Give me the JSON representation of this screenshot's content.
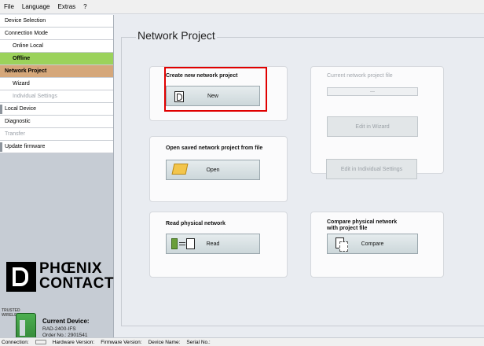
{
  "menu": {
    "items": [
      "File",
      "Language",
      "Extras",
      "?"
    ]
  },
  "sidebar": {
    "items": [
      {
        "label": "Device Selection",
        "style": "normal"
      },
      {
        "label": "Connection Mode",
        "style": "normal"
      },
      {
        "label": "Online Local",
        "style": "sub"
      },
      {
        "label": "Offline",
        "style": "offline"
      },
      {
        "label": "Network Project",
        "style": "active"
      },
      {
        "label": "Wizard",
        "style": "sub"
      },
      {
        "label": "Individual Settings",
        "style": "sub-disabled"
      },
      {
        "label": "Local Device",
        "style": "marked"
      },
      {
        "label": "Diagnostic",
        "style": "normal"
      },
      {
        "label": "Transfer",
        "style": "disabled"
      },
      {
        "label": "Update firmware",
        "style": "marked"
      }
    ],
    "logo": {
      "line1": "PHŒNIX",
      "line2": "CONTACT"
    },
    "trusted_badge": {
      "line1": "TRUSTED",
      "line2": "WIRELESS"
    },
    "current_device": {
      "label": "Current Device:",
      "model": "RAD-2400-IFS",
      "order": "Order No.: 2901541"
    }
  },
  "main": {
    "title": "Network Project",
    "create": {
      "title": "Create new network project",
      "button": "New"
    },
    "current_file": {
      "title": "Current network project file",
      "value": "---",
      "edit_wizard": "Edit in Wizard",
      "edit_individual": "Edit in Individual Settings"
    },
    "open": {
      "title": "Open saved network project from file",
      "button": "Open"
    },
    "read": {
      "title": "Read physical network",
      "button": "Read"
    },
    "compare": {
      "title_line1": "Compare physical network",
      "title_line2": "with project file",
      "button": "Compare"
    }
  },
  "statusbar": {
    "connection": "Connection:",
    "hardware": "Hardware Version:",
    "firmware": "Firmware Version:",
    "device_name": "Device Name:",
    "serial": "Serial No.:"
  },
  "colors": {
    "offline": "#9bd25b",
    "active": "#d5a77a",
    "highlight": "#e00000"
  }
}
